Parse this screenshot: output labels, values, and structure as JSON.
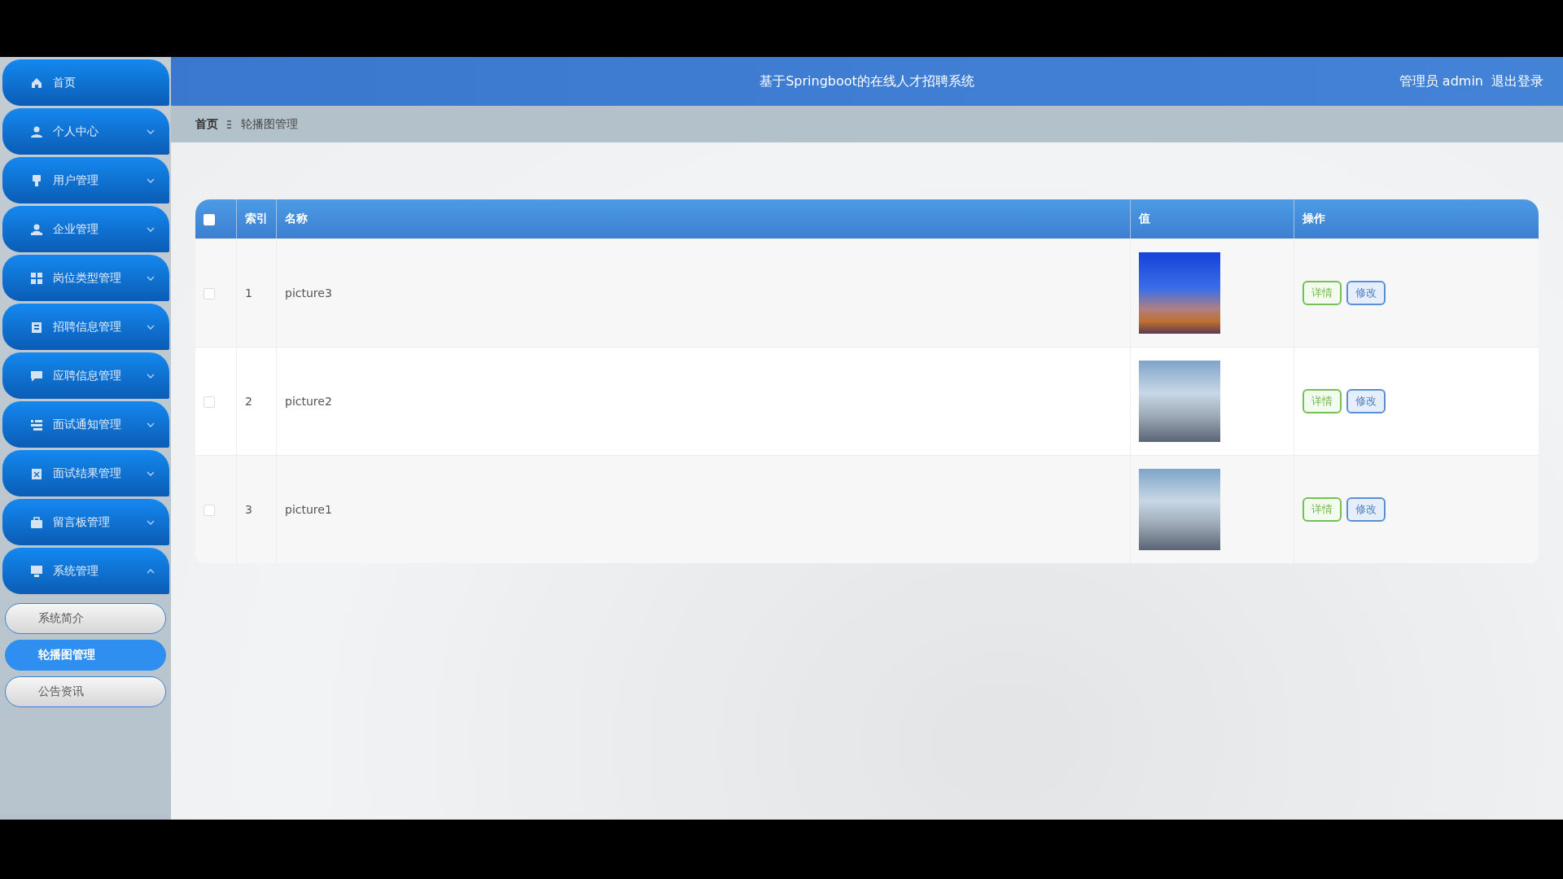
{
  "header": {
    "title": "基于Springboot的在线人才招聘系统",
    "user": "管理员 admin",
    "logout": "退出登录"
  },
  "breadcrumb": {
    "home": "首页",
    "current": "轮播图管理"
  },
  "sidebar": {
    "items": [
      {
        "kind": "link",
        "label": "首页"
      },
      {
        "kind": "menu",
        "label": "个人中心",
        "expanded": false
      },
      {
        "kind": "menu",
        "label": "用户管理",
        "expanded": false
      },
      {
        "kind": "menu",
        "label": "企业管理",
        "expanded": false
      },
      {
        "kind": "menu",
        "label": "岗位类型管理",
        "expanded": false
      },
      {
        "kind": "menu",
        "label": "招聘信息管理",
        "expanded": false
      },
      {
        "kind": "menu",
        "label": "应聘信息管理",
        "expanded": false
      },
      {
        "kind": "menu",
        "label": "面试通知管理",
        "expanded": false
      },
      {
        "kind": "menu",
        "label": "面试结果管理",
        "expanded": false
      },
      {
        "kind": "menu",
        "label": "留言板管理",
        "expanded": false
      },
      {
        "kind": "menu",
        "label": "系统管理",
        "expanded": true,
        "children": [
          {
            "label": "系统简介",
            "selected": false
          },
          {
            "label": "轮播图管理",
            "selected": true
          },
          {
            "label": "公告资讯",
            "selected": false
          }
        ]
      }
    ]
  },
  "table": {
    "select_all_checked": false,
    "columns": [
      "索引",
      "名称",
      "值",
      "操作"
    ],
    "rows": [
      {
        "checked": false,
        "index": "1",
        "name": "picture3",
        "actions": [
          "详情",
          "修改"
        ]
      },
      {
        "checked": false,
        "index": "2",
        "name": "picture2",
        "actions": [
          "详情",
          "修改"
        ]
      },
      {
        "checked": false,
        "index": "3",
        "name": "picture1",
        "actions": [
          "详情",
          "修改"
        ]
      }
    ]
  }
}
